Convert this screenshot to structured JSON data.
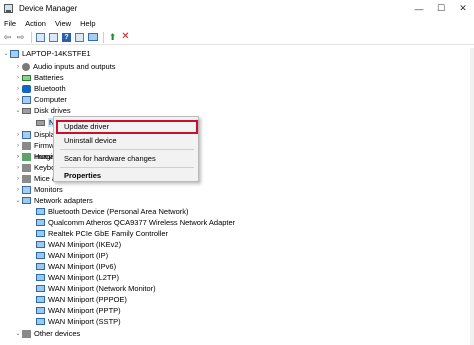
{
  "window": {
    "title": "Device Manager"
  },
  "menubar": {
    "items": [
      "File",
      "Action",
      "View",
      "Help"
    ]
  },
  "tree": {
    "root": "LAPTOP-14KSTFE1",
    "nodes": [
      "Audio inputs and outputs",
      "Batteries",
      "Bluetooth",
      "Computer",
      "Disk drives",
      "N",
      "Display adapters",
      "Firmw",
      "Human",
      "Imagin",
      "Keybo",
      "Mice a",
      "Monitors",
      "Network adapters",
      "Bluetooth Device (Personal Area Network)",
      "Qualcomm Atheros QCA9377 Wireless Network Adapter",
      "Realtek PCIe GbE Family Controller",
      "WAN Miniport (IKEv2)",
      "WAN Miniport (IP)",
      "WAN Miniport (IPv6)",
      "WAN Miniport (L2TP)",
      "WAN Miniport (Network Monitor)",
      "WAN Miniport (PPPOE)",
      "WAN Miniport (PPTP)",
      "WAN Miniport (SSTP)",
      "Other devices"
    ]
  },
  "context_menu": {
    "items": [
      "Update driver",
      "Uninstall device",
      "Scan for hardware changes",
      "Properties"
    ],
    "highlight_color": "#c8102e"
  }
}
